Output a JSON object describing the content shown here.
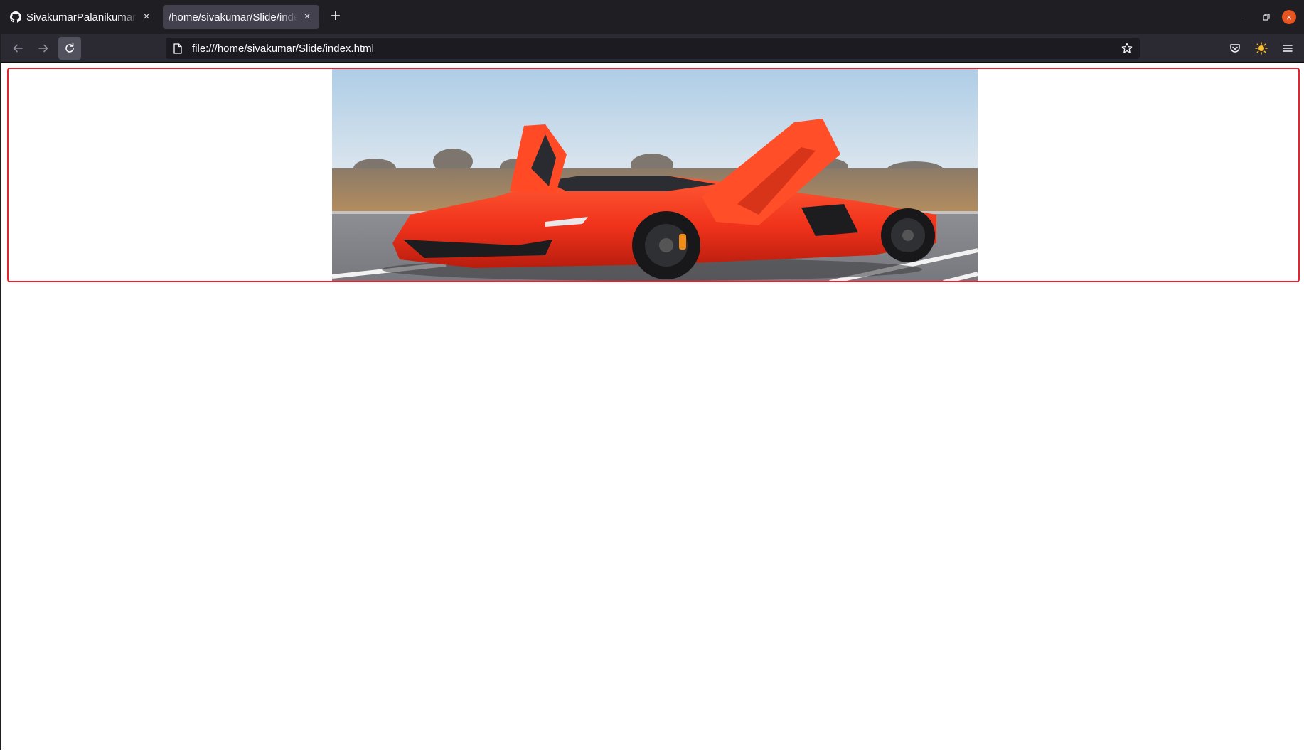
{
  "tabs": [
    {
      "title": "SivakumarPalanikumarC/",
      "favicon": "github-icon",
      "active": false
    },
    {
      "title": "/home/sivakumar/Slide/index.html",
      "favicon": "none",
      "active": true
    }
  ],
  "new_tab_label": "+",
  "close_glyph": "×",
  "window_controls": {
    "minimize": "–",
    "maximize": "▫",
    "close": "×"
  },
  "address_bar": {
    "url": "file:///home/sivakumar/Slide/index.html"
  },
  "toolbar_icons": [
    "back-arrow-icon",
    "forward-arrow-icon",
    "reload-icon",
    "page-icon",
    "bookmark-star-icon",
    "pocket-icon",
    "theme-sun-icon",
    "hamburger-menu-icon"
  ],
  "colors": {
    "slide_border": "#e5222f",
    "car_body": "#f0321b",
    "tabbar": "#1f1e22",
    "navbar": "#2b2a33"
  },
  "slide": {
    "image_subject": "red sports car with open scissor doors in parking lot"
  }
}
